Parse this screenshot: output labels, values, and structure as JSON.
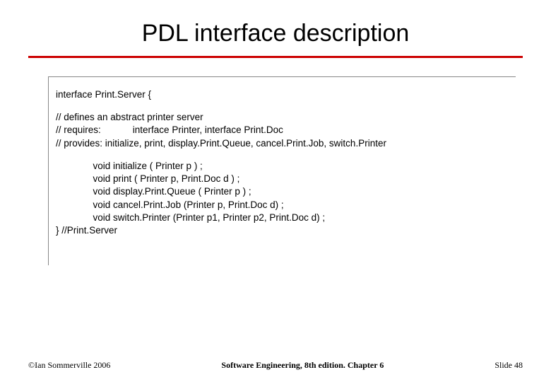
{
  "title": "PDL interface description",
  "code": {
    "line1": "interface Print.Server {",
    "c1": "// defines an abstract printer server",
    "c2": "// requires:            interface Printer, interface Print.Doc",
    "c3": "// provides: initialize, print, display.Print.Queue, cancel.Print.Job, switch.Printer",
    "m1": "              void initialize ( Printer p ) ;",
    "m2": "              void print ( Printer p, Print.Doc d ) ;",
    "m3": "              void display.Print.Queue ( Printer p ) ;",
    "m4": "              void cancel.Print.Job (Printer p, Print.Doc d) ;",
    "m5": "              void switch.Printer (Printer p1, Printer p2, Print.Doc d) ;",
    "close": "} //Print.Server"
  },
  "footer": {
    "left": "©Ian Sommerville 2006",
    "center": "Software Engineering, 8th edition. Chapter 6",
    "right": "Slide 48"
  }
}
